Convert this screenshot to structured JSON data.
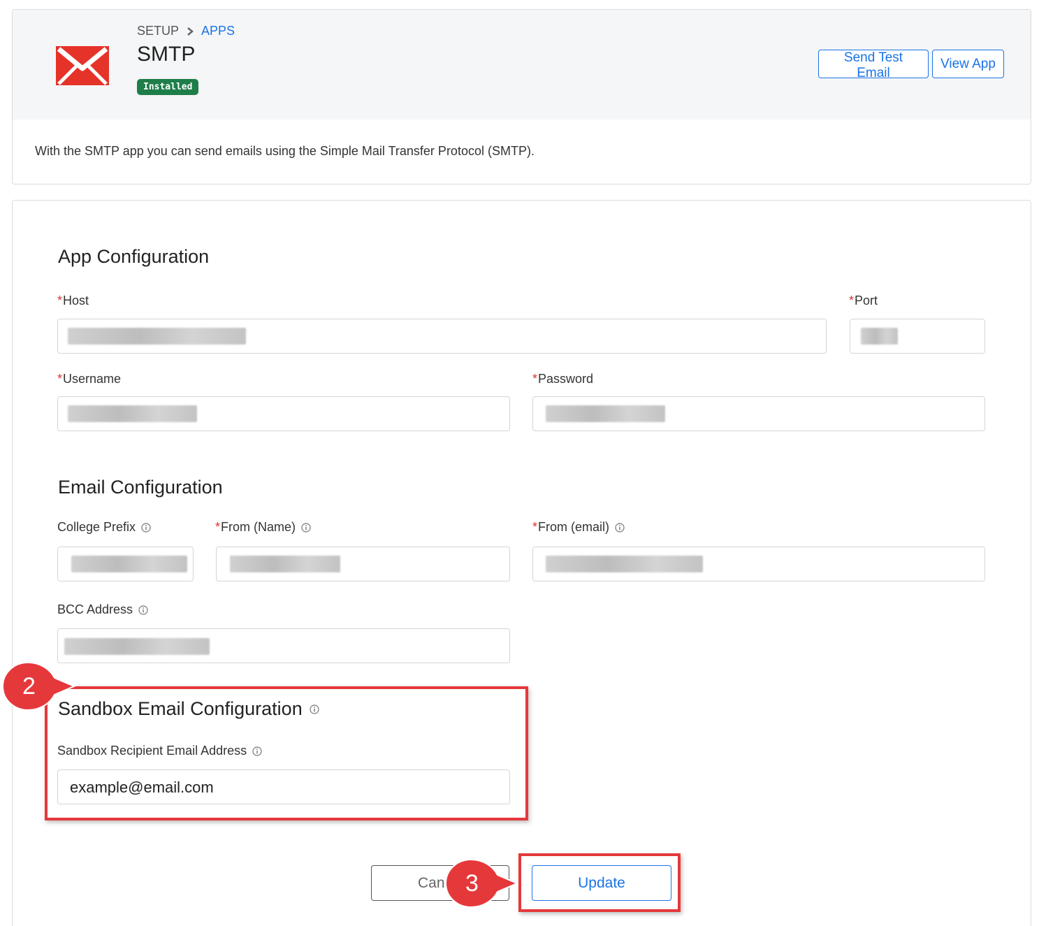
{
  "header": {
    "breadcrumb": [
      "SETUP",
      "APPS"
    ],
    "title": "SMTP",
    "status_badge": "Installed",
    "buttons": {
      "send_test": "Send Test Email",
      "view_app": "View App"
    },
    "description": "With the SMTP app you can send emails using the Simple Mail Transfer Protocol (SMTP).",
    "logo_icon": "envelope-icon",
    "logo_color": "#e5332a"
  },
  "app_config": {
    "title": "App Configuration",
    "host": {
      "label": "Host",
      "required": true,
      "value_redacted": true
    },
    "port": {
      "label": "Port",
      "required": true,
      "value_redacted": true
    },
    "username": {
      "label": "Username",
      "required": true,
      "value_redacted": true
    },
    "password": {
      "label": "Password",
      "required": true,
      "value_redacted": true
    }
  },
  "email_config": {
    "title": "Email Configuration",
    "college_prefix": {
      "label": "College Prefix",
      "required": false,
      "value_redacted": true
    },
    "from_name": {
      "label": "From (Name)",
      "required": true,
      "value_redacted": true
    },
    "from_email": {
      "label": "From (email)",
      "required": true,
      "value_redacted": true
    },
    "bcc": {
      "label": "BCC Address",
      "required": false,
      "value_redacted": true
    }
  },
  "sandbox_config": {
    "title": "Sandbox Email Configuration",
    "recipient": {
      "label": "Sandbox Recipient Email Address",
      "value": "example@email.com"
    }
  },
  "actions": {
    "cancel": "Can",
    "update": "Update"
  },
  "annotations": {
    "step_2": "2",
    "step_3": "3",
    "color": "#e5383b"
  },
  "colors": {
    "accent": "#1a73e8",
    "badge": "#1e7e4a",
    "required": "#d33333"
  }
}
